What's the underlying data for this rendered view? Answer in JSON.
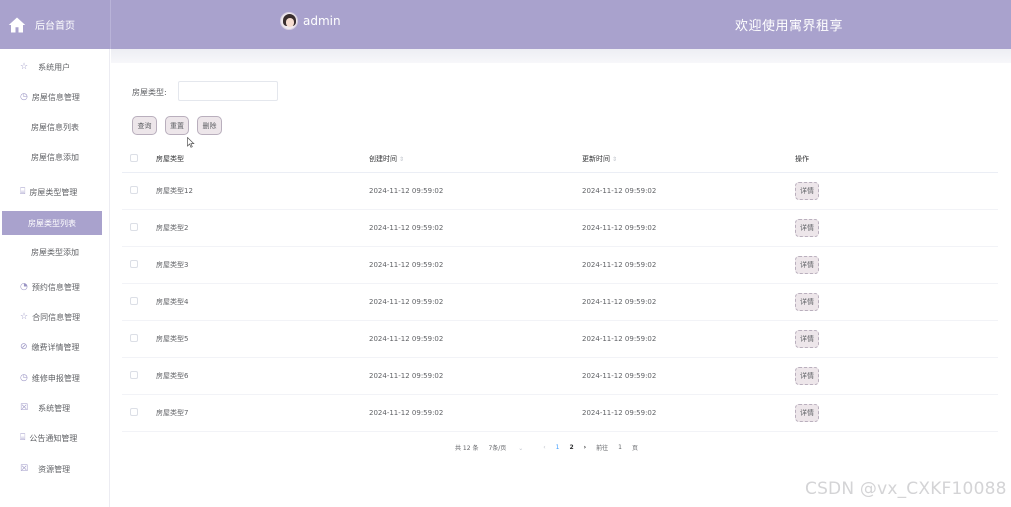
{
  "header": {
    "home_label": "后台首页",
    "username": "admin",
    "site_title": "欢迎使用寓界租享",
    "accent_color": "#a9a2cd"
  },
  "sidebar": {
    "items": [
      {
        "label": "系统用户",
        "icon": "star-icon"
      },
      {
        "label": "房屋信息管理",
        "icon": "clock-icon"
      },
      {
        "label": "房屋信息列表",
        "icon": ""
      },
      {
        "label": "房屋信息添加",
        "icon": ""
      },
      {
        "label": "房屋类型管理",
        "icon": "trash-icon"
      },
      {
        "label": "房屋类型列表",
        "icon": "",
        "active": true
      },
      {
        "label": "房屋类型添加",
        "icon": ""
      },
      {
        "label": "预约信息管理",
        "icon": "time-icon"
      },
      {
        "label": "合同信息管理",
        "icon": "star-icon"
      },
      {
        "label": "缴费详情管理",
        "icon": "compass-icon"
      },
      {
        "label": "维修申报管理",
        "icon": "clock-icon"
      },
      {
        "label": "系统管理",
        "icon": "mail-icon"
      },
      {
        "label": "公告通知管理",
        "icon": "trash-icon"
      },
      {
        "label": "资源管理",
        "icon": "mail-icon"
      }
    ]
  },
  "search": {
    "label": "房屋类型:",
    "value": "",
    "placeholder": ""
  },
  "buttons": {
    "query": "查询",
    "reset": "重置",
    "delete": "删除"
  },
  "table": {
    "columns": [
      "房屋类型",
      "创建时间",
      "更新时间",
      "操作"
    ],
    "sort_glyph": "⇕",
    "action_label": "详情",
    "rows": [
      {
        "type": "房屋类型12",
        "created": "2024-11-12 09:59:02",
        "updated": "2024-11-12 09:59:02"
      },
      {
        "type": "房屋类型2",
        "created": "2024-11-12 09:59:02",
        "updated": "2024-11-12 09:59:02"
      },
      {
        "type": "房屋类型3",
        "created": "2024-11-12 09:59:02",
        "updated": "2024-11-12 09:59:02"
      },
      {
        "type": "房屋类型4",
        "created": "2024-11-12 09:59:02",
        "updated": "2024-11-12 09:59:02"
      },
      {
        "type": "房屋类型5",
        "created": "2024-11-12 09:59:02",
        "updated": "2024-11-12 09:59:02"
      },
      {
        "type": "房屋类型6",
        "created": "2024-11-12 09:59:02",
        "updated": "2024-11-12 09:59:02"
      },
      {
        "type": "房屋类型7",
        "created": "2024-11-12 09:59:02",
        "updated": "2024-11-12 09:59:02"
      }
    ]
  },
  "pagination": {
    "total": "共 12 条",
    "page_size": "7条/页",
    "size_caret": "⌄",
    "prev": "‹",
    "pages": [
      "1",
      "2"
    ],
    "next": "›",
    "goto_label": "前往",
    "goto_value": "1",
    "page_suffix": "页"
  },
  "watermark": "CSDN @vx_CXKF10088"
}
